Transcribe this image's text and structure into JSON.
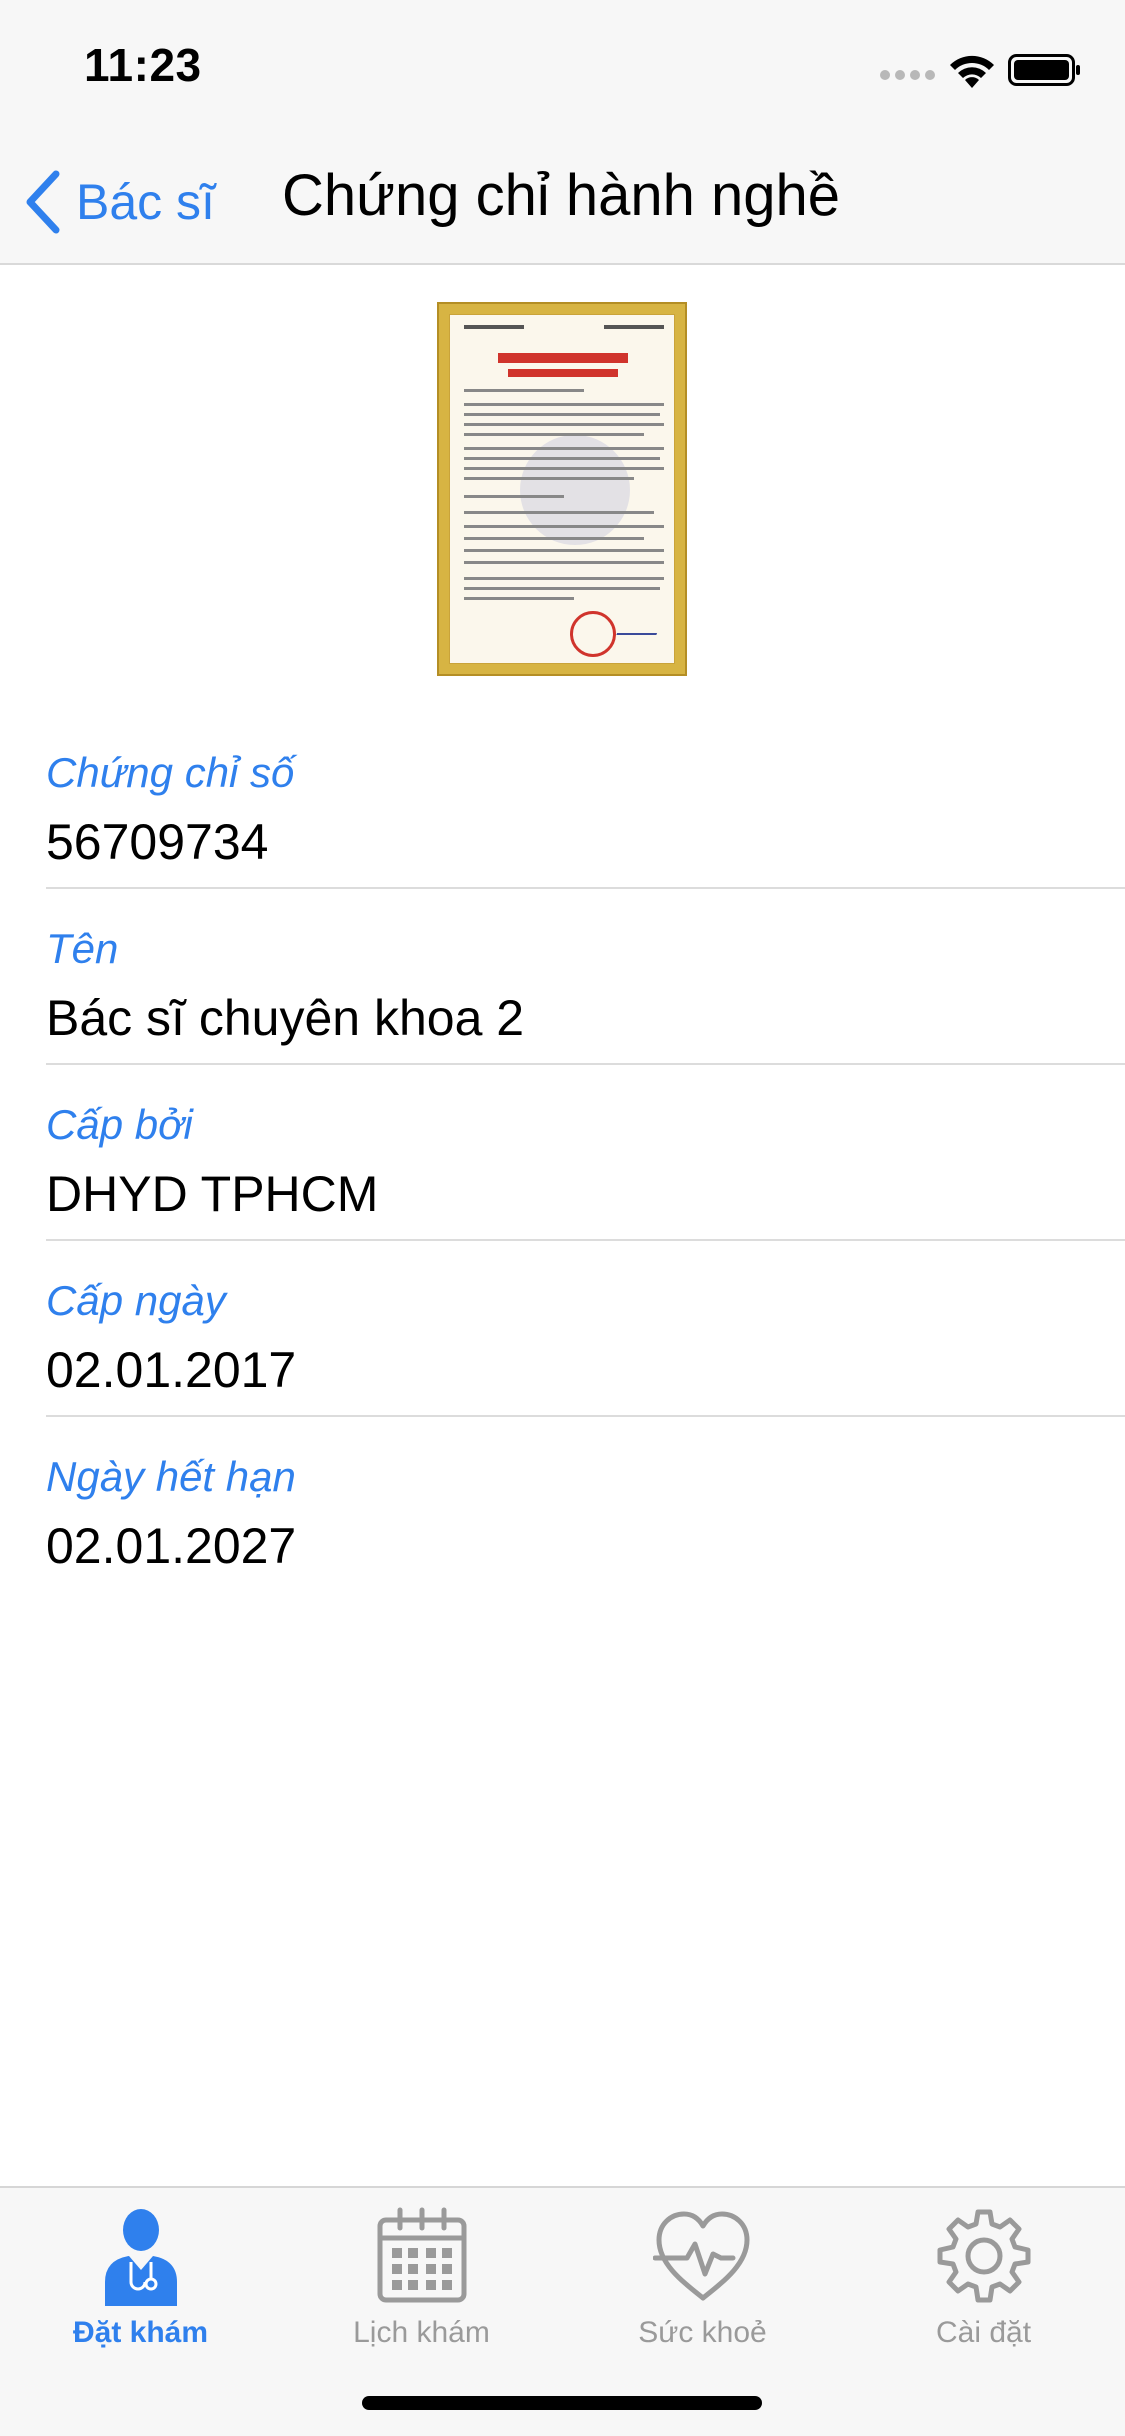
{
  "status_bar": {
    "time": "11:23"
  },
  "nav": {
    "back_label": "Bác sĩ",
    "title": "Chứng chỉ hành nghề"
  },
  "certificate_image": {
    "description_icon": "certificate-document-icon",
    "accent_color": "#d7b443"
  },
  "fields": [
    {
      "label": "Chứng chỉ số",
      "value": "56709734"
    },
    {
      "label": "Tên",
      "value": "Bác sĩ chuyên khoa 2"
    },
    {
      "label": "Cấp bởi",
      "value": "DHYD TPHCM"
    },
    {
      "label": "Cấp ngày",
      "value": "02.01.2017"
    },
    {
      "label": "Ngày hết hạn",
      "value": "02.01.2027"
    }
  ],
  "tabs": [
    {
      "label": "Đặt khám",
      "icon": "doctor-icon",
      "active": true
    },
    {
      "label": "Lịch khám",
      "icon": "calendar-icon",
      "active": false
    },
    {
      "label": "Sức khoẻ",
      "icon": "heart-pulse-icon",
      "active": false
    },
    {
      "label": "Cài đặt",
      "icon": "gear-icon",
      "active": false
    }
  ],
  "colors": {
    "accent": "#2f80ed",
    "inactive": "#9a9a9a",
    "bar_bg": "#f7f7f7"
  }
}
